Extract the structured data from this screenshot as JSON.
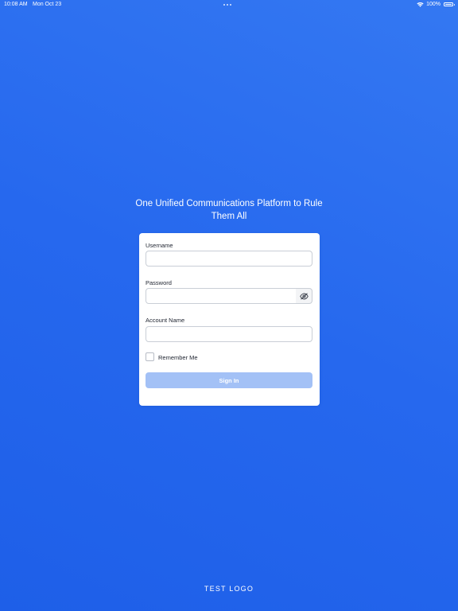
{
  "status_bar": {
    "time": "10:08 AM",
    "date": "Mon Oct 23",
    "battery": "100%"
  },
  "headline": "One Unified Communications Platform to Rule Them All",
  "login_form": {
    "username_label": "Username",
    "username_value": "",
    "password_label": "Password",
    "password_value": "",
    "account_label": "Account Name",
    "account_value": "",
    "remember_label": "Remember Me",
    "remember_checked": false,
    "sign_in_label": "Sign In"
  },
  "footer": {
    "logo_text": "TEST LOGO"
  },
  "colors": {
    "background_top": "#3478f2",
    "background_bottom": "#1e5fe8",
    "sign_in_disabled": "#a3c1f6"
  },
  "icons": {
    "wifi": "wifi-icon",
    "battery": "battery-icon",
    "password_toggle": "eye-slash-icon"
  }
}
